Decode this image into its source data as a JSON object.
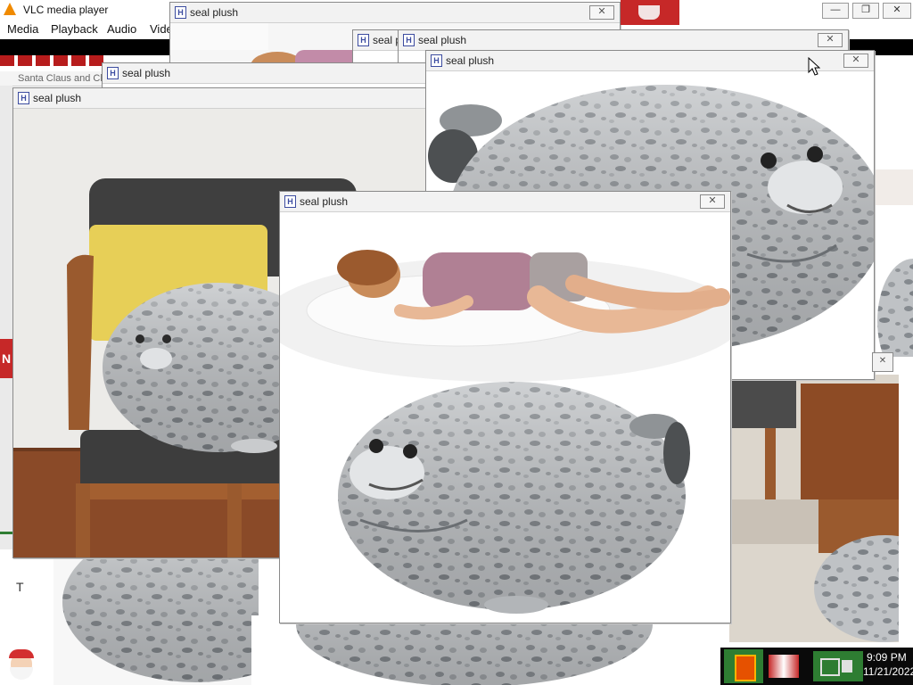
{
  "vlc": {
    "title": "VLC media player",
    "menu": [
      "Media",
      "Playback",
      "Audio",
      "Vide"
    ],
    "btn_min": "—",
    "btn_restore": "❐",
    "btn_close": "✕"
  },
  "windows": {
    "w1_title": "seal plush",
    "w2_title": "seal p",
    "w3_title": "seal plush",
    "w4_title": "seal plush",
    "w5_title": "seal plush",
    "w6_title": "seal plush",
    "w_main_title": "seal plush",
    "icon_letter": "H",
    "close_glyph": "✕"
  },
  "background": {
    "partial_text": "Santa Claus and Chi...",
    "left_letter": "T",
    "red_letter": "N"
  },
  "taskbar": {
    "time": "9:09 PM",
    "date": "11/21/2022"
  },
  "colors": {
    "seal_body": "#b9bcbf",
    "seal_spot": "#7d8185",
    "chair_wood": "#9a5a2e",
    "pillow_yellow": "#e7cf57",
    "floor_wood": "#8a4a28"
  }
}
